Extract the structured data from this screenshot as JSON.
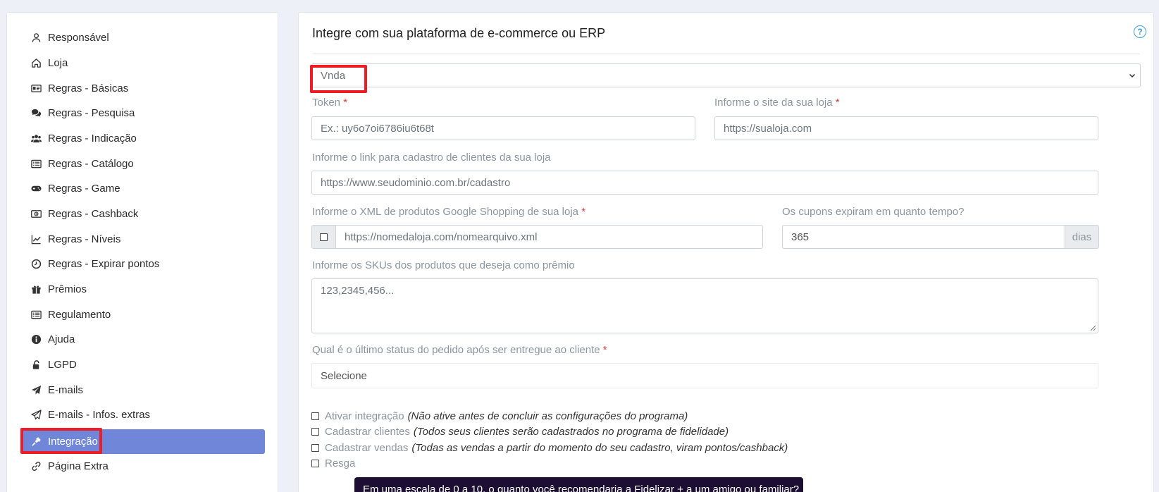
{
  "sidebar": {
    "items": [
      {
        "label": "Responsável",
        "icon": "user-icon"
      },
      {
        "label": "Loja",
        "icon": "home-icon"
      },
      {
        "label": "Regras - Básicas",
        "icon": "id-card-icon"
      },
      {
        "label": "Regras - Pesquisa",
        "icon": "comments-icon"
      },
      {
        "label": "Regras - Indicação",
        "icon": "users-icon"
      },
      {
        "label": "Regras - Catálogo",
        "icon": "list-icon"
      },
      {
        "label": "Regras - Game",
        "icon": "gamepad-icon"
      },
      {
        "label": "Regras - Cashback",
        "icon": "money-icon"
      },
      {
        "label": "Regras - Níveis",
        "icon": "chart-line-icon"
      },
      {
        "label": "Regras - Expirar pontos",
        "icon": "clock-icon"
      },
      {
        "label": "Prêmios",
        "icon": "gift-icon"
      },
      {
        "label": "Regulamento",
        "icon": "list-icon"
      },
      {
        "label": "Ajuda",
        "icon": "info-icon"
      },
      {
        "label": "LGPD",
        "icon": "unlock-icon"
      },
      {
        "label": "E-mails",
        "icon": "paper-plane-icon"
      },
      {
        "label": "E-mails - Infos. extras",
        "icon": "paper-plane-outline-icon"
      },
      {
        "label": "Integração",
        "icon": "plug-icon",
        "active": true
      },
      {
        "label": "Página Extra",
        "icon": "link-icon"
      }
    ]
  },
  "panel": {
    "title": "Integre com sua plataforma de e-commerce ou ERP",
    "platform_value": "Vnda",
    "token_label": "Token",
    "token_placeholder": "Ex.: uy6o7oi6786iu6t68t",
    "site_label": "Informe o site da sua loja",
    "site_placeholder": "https://sualoja.com",
    "signup_link_label": "Informe o link para cadastro de clientes da sua loja",
    "signup_link_placeholder": "https://www.seudominio.com.br/cadastro",
    "xml_label": "Informe o XML de produtos Google Shopping de sua loja",
    "xml_placeholder": "https://nomedaloja.com/nomearquivo.xml",
    "coupon_label": "Os cupons expiram em quanto tempo?",
    "coupon_value": "365",
    "coupon_unit": "dias",
    "sku_label": "Informe os SKUs dos produtos que deseja como prêmio",
    "sku_placeholder": "123,2345,456...",
    "status_label": "Qual é o último status do pedido após ser entregue ao cliente",
    "status_value": "Selecione",
    "required_mark": "*",
    "checks": [
      {
        "label": "Ativar integração",
        "note": "(Não ative antes de concluir as configurações do programa)"
      },
      {
        "label": "Cadastrar clientes",
        "note": "(Todos seus clientes serão cadastrados no programa de fidelidade)"
      },
      {
        "label": "Cadastrar vendas",
        "note": "(Todas as vendas a partir do momento do seu cadastro, viram pontos/cashback)"
      },
      {
        "label": "Resga",
        "note": ""
      }
    ]
  },
  "toast": {
    "text": "Em uma escala de 0 a 10, o quanto você recomendaria a Fidelizar + a um amigo ou familiar?"
  }
}
